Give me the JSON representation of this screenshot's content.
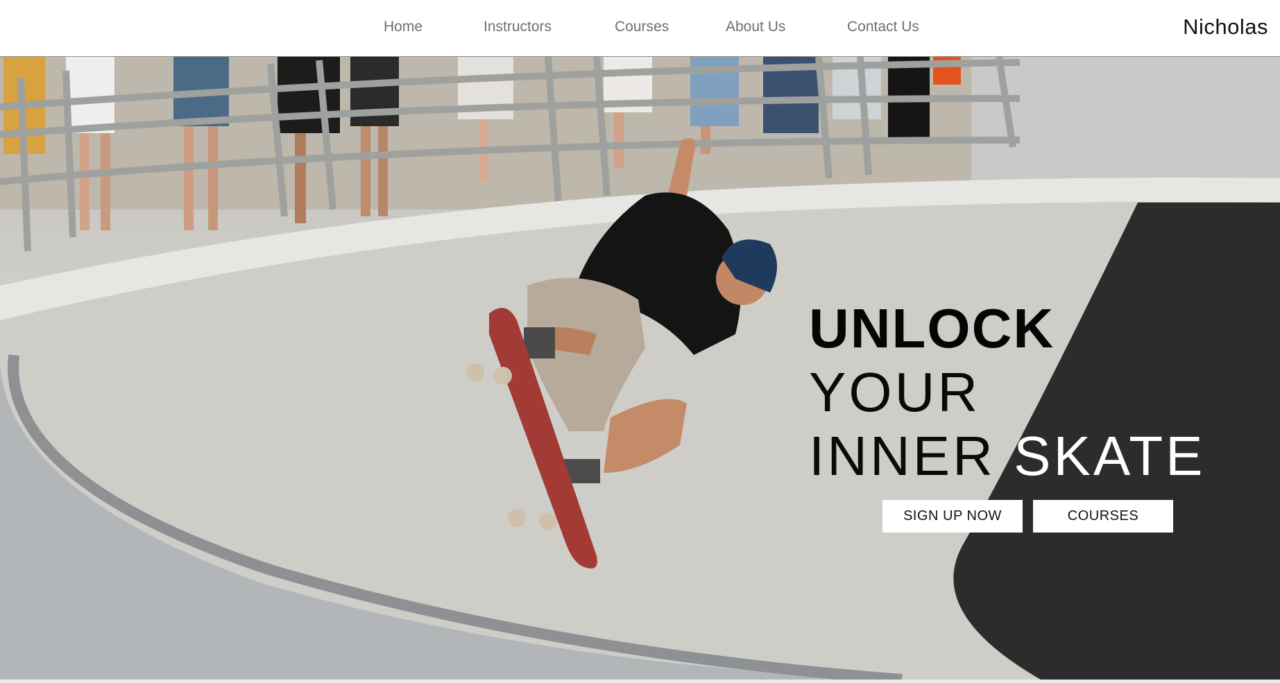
{
  "header": {
    "nav": [
      "Home",
      "Instructors",
      "Courses",
      "About Us",
      "Contact Us"
    ],
    "brand": "Nicholas"
  },
  "hero": {
    "headline": {
      "line1": "UNLOCK",
      "line2": "YOUR",
      "line3_dark": "INNER",
      "line3_light": "SKATE"
    },
    "buttons": {
      "signup": "SIGN UP NOW",
      "courses": "COURSES"
    },
    "image": "skateboarder-in-bowl",
    "colors": {
      "accent_text": "#ffffff",
      "dark_text": "#050505",
      "button_bg": "#ffffff"
    }
  }
}
